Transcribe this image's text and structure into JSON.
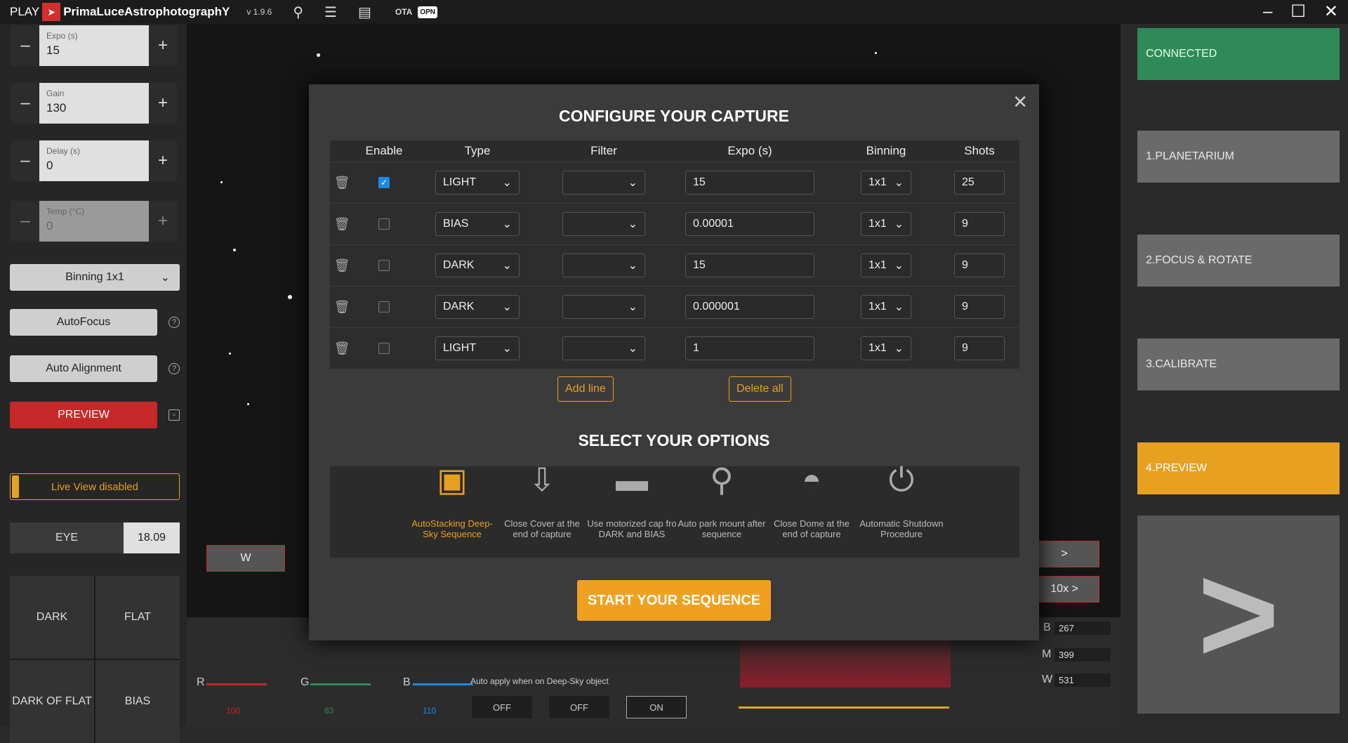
{
  "app": {
    "play": "PLAY",
    "brand": "PrimaLuceAstrophotographY",
    "version": "v 1.9.6",
    "ota": "OTA",
    "opn": "OPN"
  },
  "left": {
    "expo": {
      "label": "Expo (s)",
      "value": "15"
    },
    "gain": {
      "label": "Gain",
      "value": "130"
    },
    "delay": {
      "label": "Delay (s)",
      "value": "0"
    },
    "temp": {
      "label": "Temp (°C)",
      "value": "0"
    },
    "binning": "Binning 1x1",
    "autofocus": "AutoFocus",
    "autoalign": "Auto Alignment",
    "preview": "PREVIEW",
    "liveview": "Live View disabled",
    "eye_label": "EYE",
    "eye_value": "18.09",
    "grid": [
      "DARK",
      "FLAT",
      "DARK OF FLAT",
      "BIAS"
    ]
  },
  "right": {
    "connected": "CONNECTED",
    "planetarium": "1.PLANETARIUM",
    "focus": "2.FOCUS & ROTATE",
    "calibrate": "3.CALIBRATE",
    "preview": "4.PREVIEW"
  },
  "modal": {
    "title": "CONFIGURE YOUR CAPTURE",
    "headers": {
      "enable": "Enable",
      "type": "Type",
      "filter": "Filter",
      "expo": "Expo (s)",
      "binning": "Binning",
      "shots": "Shots"
    },
    "rows": [
      {
        "enabled": true,
        "type": "LIGHT",
        "filter": "",
        "expo": "15",
        "binning": "1x1",
        "shots": "25"
      },
      {
        "enabled": false,
        "type": "BIAS",
        "filter": "",
        "expo": "0.00001",
        "binning": "1x1",
        "shots": "9"
      },
      {
        "enabled": false,
        "type": "DARK",
        "filter": "",
        "expo": "15",
        "binning": "1x1",
        "shots": "9"
      },
      {
        "enabled": false,
        "type": "DARK",
        "filter": "",
        "expo": "0.000001",
        "binning": "1x1",
        "shots": "9"
      },
      {
        "enabled": false,
        "type": "LIGHT",
        "filter": "",
        "expo": "1",
        "binning": "1x1",
        "shots": "9"
      }
    ],
    "add_line": "Add line",
    "delete_all": "Delete all",
    "options_title": "SELECT YOUR OPTIONS",
    "options": [
      {
        "icon": "autostacking-icon",
        "label": "AutoStacking Deep-Sky Sequence",
        "active": true
      },
      {
        "icon": "cover-icon",
        "label": "Close Cover at the end of capture",
        "active": false
      },
      {
        "icon": "cap-icon",
        "label": "Use motorized cap fro DARK and BIAS",
        "active": false
      },
      {
        "icon": "telescope-park-icon",
        "label": "Auto park mount after sequence",
        "active": false
      },
      {
        "icon": "dome-icon",
        "label": "Close Dome at the end of capture",
        "active": false
      },
      {
        "icon": "power-icon",
        "label": "Automatic Shutdown Procedure",
        "active": false
      }
    ],
    "start": "START YOUR SEQUENCE"
  },
  "bottom": {
    "r": "R",
    "g": "G",
    "b": "B",
    "rv": "100",
    "gv": "83",
    "bv": "110",
    "auto_apply": "Auto apply when on Deep-Sky object",
    "off1": "OFF",
    "off2": "OFF",
    "on": "ON",
    "bl": "B",
    "ml": "M",
    "wl": "W",
    "bval": "267",
    "mval": "399",
    "wval": "531",
    "w_btn": "W",
    "zoom": "10x >",
    "next": ">"
  }
}
